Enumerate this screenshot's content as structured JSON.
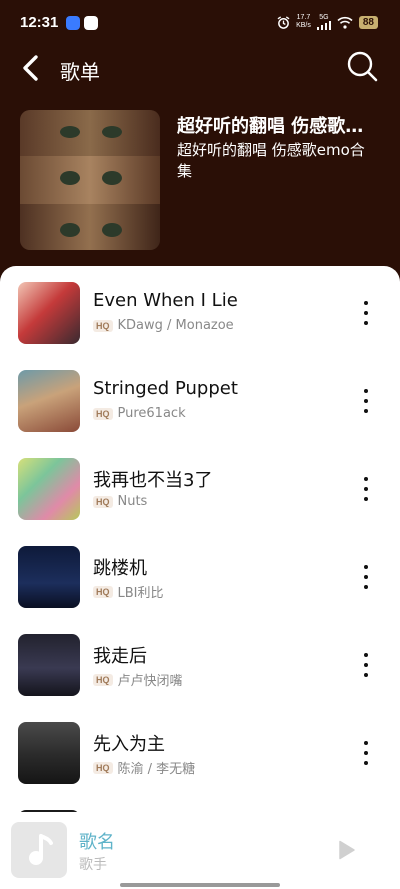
{
  "status_bar": {
    "time": "12:31",
    "net_speed_value": "17.7",
    "net_speed_unit": "KB/s",
    "network": "5G",
    "battery": "88"
  },
  "header": {
    "title": "歌单",
    "back_icon": "back-arrow-icon",
    "search_icon": "search-icon"
  },
  "playlist": {
    "title": "超好听的翻唱 伤感歌…",
    "description": "超好听的翻唱 伤感歌emo合集"
  },
  "songs": [
    {
      "title": "Even When I Lie",
      "badge": "HQ",
      "artist": "KDawg / Monazoe"
    },
    {
      "title": "Stringed Puppet",
      "badge": "HQ",
      "artist": "Pure61ack"
    },
    {
      "title": "我再也不当3了",
      "badge": "HQ",
      "artist": "Nuts"
    },
    {
      "title": "跳楼机",
      "badge": "HQ",
      "artist": "LBI利比"
    },
    {
      "title": "我走后",
      "badge": "HQ",
      "artist": "卢卢快闭嘴"
    },
    {
      "title": "先入为主",
      "badge": "HQ",
      "artist": "陈渝 / 李无糖"
    }
  ],
  "mini_player": {
    "title": "歌名",
    "artist": "歌手",
    "play_icon": "play-icon"
  },
  "colors": {
    "header_bg": "#2a0f06",
    "accent": "#5fb3c9",
    "battery": "#c8b070"
  }
}
